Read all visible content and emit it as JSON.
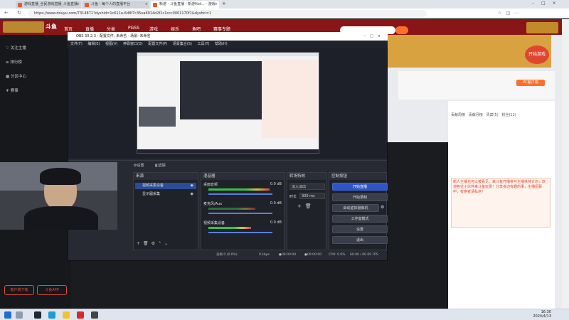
{
  "browser": {
    "tabs": [
      {
        "title": "游戏直播_全民游戏直播_斗鱼直播"
      },
      {
        "title": "斗鱼 - 每个人的直播平台"
      },
      {
        "title": "新游 - 斗鱼直播 - 新游Hot… - 游戏"
      }
    ],
    "url": "https://www.douyu.com/7314871?dyshid=1c611a-6d8f7c35ea6914d2f1c1ccc0001170f1&dyshci=1"
  },
  "site": {
    "logo": "斗鱼",
    "nav": [
      "首页",
      "直播",
      "分类",
      "PGSS",
      "游戏",
      "娱乐",
      "鱼吧",
      "赛事专题"
    ],
    "search_placeholder": "",
    "left_nav": [
      {
        "label": "关注主播",
        "icon": "heart-icon"
      },
      {
        "label": "排行榜",
        "icon": "list-icon"
      },
      {
        "label": "分区中心",
        "icon": "grid-icon"
      },
      {
        "label": "赛事",
        "icon": "trophy-icon"
      }
    ],
    "left_buttons": [
      "客户端下载",
      "斗鱼APP"
    ],
    "right_panel": {
      "tabs": [
        "贡献周榜",
        "贡献月榜",
        "贵宾(5)",
        "粉丝(12)"
      ],
      "notice": "新人主播也可以被看见，来斗鱼开播参与主播扶持计划，欢迎各位小伙伴来斗鱼玩耍！分享身边有趣的事，主播招募中，有意者请私信！"
    },
    "promo_badges": [
      "开始游戏"
    ],
    "follow_label": "PC客户端"
  },
  "obs": {
    "title": "OBS 30.2.3 - 配置文件: 未命名 - 场景: 未命名",
    "menu": [
      "文件(F)",
      "编辑(E)",
      "视图(V)",
      "停靠窗口(D)",
      "配置文件(P)",
      "场景集合(S)",
      "工具(T)",
      "帮助(H)"
    ],
    "ctrl_row": [
      "设置",
      "滤镜"
    ],
    "docks": {
      "sources": {
        "title": "来源",
        "items": [
          "视频采集设备",
          "显示器采集"
        ]
      },
      "mixer": {
        "title": "混音器",
        "channels": [
          {
            "name": "桌面音频",
            "level": "0.0 dB"
          },
          {
            "name": "麦克风/Aux",
            "level": "0.0 dB"
          },
          {
            "name": "视频采集设备",
            "level": "0.0 dB"
          }
        ]
      },
      "transitions": {
        "title": "转场特效",
        "type": "淡入淡出",
        "duration_label": "时长",
        "duration": "300 ms"
      },
      "controls": {
        "title": "控制按钮",
        "buttons": [
          "开始直播",
          "开始录制",
          "启动虚拟摄像机",
          "工作室模式",
          "设置",
          "退出"
        ]
      }
    },
    "status": {
      "dropped": "丢帧 0 (0.0%)",
      "kbps": "0 kbps",
      "live": "00:00:00",
      "rec": "00:00:00",
      "cpu": "CPU: 0.6%",
      "fps": "60.00 / 60.00 FPS"
    }
  },
  "taskbar": {
    "time": "16:30",
    "date": "2024/4/13"
  }
}
